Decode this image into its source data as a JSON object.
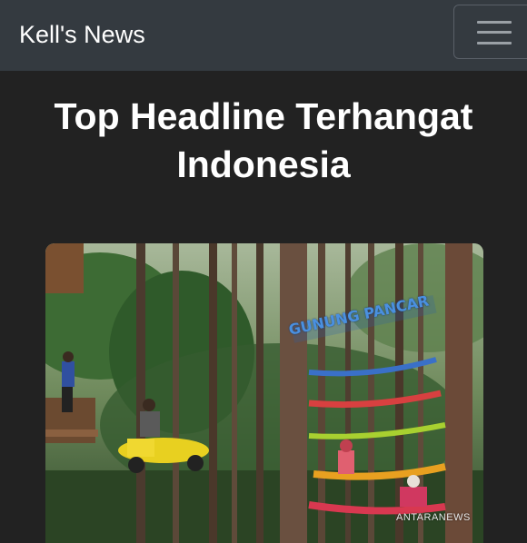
{
  "navbar": {
    "brand": "Kell's News",
    "toggle_icon": "hamburger-icon"
  },
  "main": {
    "headline": "Top Headline Terhangat Indonesia",
    "card": {
      "image_sign_text": "GUNUNG PANCAR",
      "image_watermark": "ANTARANEWS"
    }
  },
  "colors": {
    "navbar_bg": "#343a40",
    "page_bg": "#222222",
    "text": "#ffffff"
  }
}
